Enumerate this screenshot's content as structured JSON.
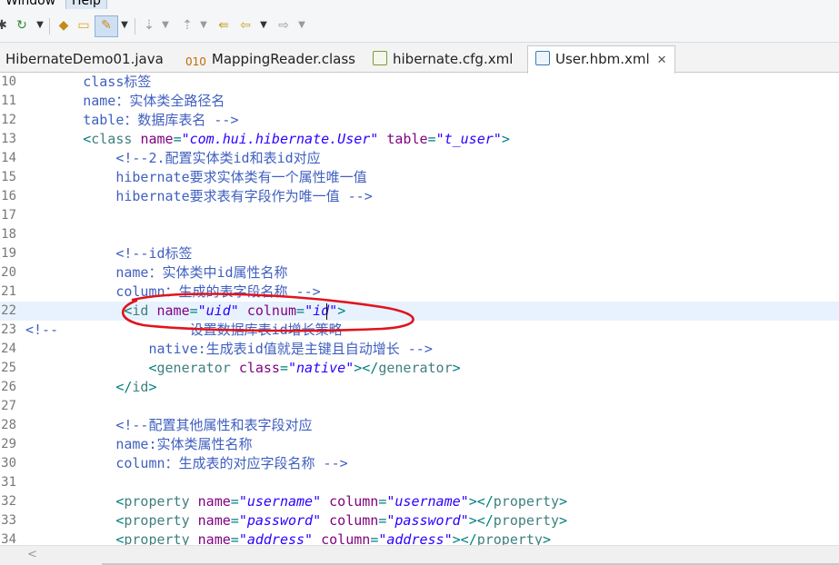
{
  "menubar": {
    "window": "Window",
    "help": "Help"
  },
  "tabs": [
    {
      "label": "HibernateDemo01.java",
      "icon": "java-file-icon"
    },
    {
      "label": "MappingReader.class",
      "icon": "class-file-icon",
      "icon_text": "010"
    },
    {
      "label": "hibernate.cfg.xml",
      "icon": "xml-file-icon"
    },
    {
      "label": "User.hbm.xml",
      "icon": "hbm-xml-file-icon",
      "active": true,
      "close": "✕"
    }
  ],
  "editor": {
    "lines": [
      {
        "n": "10",
        "indent": "       ",
        "segs": [
          [
            "c-com",
            "class标签"
          ]
        ]
      },
      {
        "n": "11",
        "indent": "       ",
        "segs": [
          [
            "c-com",
            "name：实体类全路径名"
          ]
        ]
      },
      {
        "n": "12",
        "indent": "       ",
        "segs": [
          [
            "c-com",
            "table：数据库表名 -->"
          ]
        ]
      },
      {
        "n": "13",
        "indent": "       ",
        "segs": [
          [
            "c-punc",
            "<"
          ],
          [
            "c-tag",
            "class "
          ],
          [
            "c-attr",
            "name"
          ],
          [
            "c-punc",
            "="
          ],
          [
            "c-str",
            "\"com.hui.hibernate.User\""
          ],
          [
            "c-attr",
            " table"
          ],
          [
            "c-punc",
            "="
          ],
          [
            "c-str",
            "\"t_user\""
          ],
          [
            "c-punc",
            ">"
          ]
        ]
      },
      {
        "n": "14",
        "indent": "           ",
        "segs": [
          [
            "c-com",
            "<!--2.配置实体类id和表id对应"
          ]
        ]
      },
      {
        "n": "15",
        "indent": "           ",
        "segs": [
          [
            "c-com",
            "hibernate要求实体类有一个属性唯一值"
          ]
        ]
      },
      {
        "n": "16",
        "indent": "           ",
        "segs": [
          [
            "c-com",
            "hibernate要求表有字段作为唯一值 -->"
          ]
        ]
      },
      {
        "n": "17",
        "indent": "",
        "segs": []
      },
      {
        "n": "18",
        "indent": "",
        "segs": []
      },
      {
        "n": "19",
        "indent": "           ",
        "segs": [
          [
            "c-com",
            "<!--id标签"
          ]
        ]
      },
      {
        "n": "20",
        "indent": "           ",
        "segs": [
          [
            "c-com",
            "name：实体类中id属性名称"
          ]
        ]
      },
      {
        "n": "21",
        "indent": "           ",
        "segs": [
          [
            "c-com",
            "column：生成的表字段名称 -->"
          ]
        ]
      },
      {
        "n": "22",
        "indent": "            ",
        "current": true,
        "segs": [
          [
            "c-punc",
            "<"
          ],
          [
            "c-tag",
            "id "
          ],
          [
            "c-attr",
            "name"
          ],
          [
            "c-punc",
            "="
          ],
          [
            "c-str",
            "\"uid\""
          ],
          [
            "c-attr",
            " colnum"
          ],
          [
            "c-punc",
            "="
          ],
          [
            "c-str",
            "\"id\""
          ],
          [
            "c-punc",
            ">"
          ]
        ]
      },
      {
        "n": "23",
        "indent": "",
        "segs": [
          [
            "c-com",
            "<!--                设置数据库表id增长策略"
          ]
        ]
      },
      {
        "n": "24",
        "indent": "               ",
        "segs": [
          [
            "c-com",
            "native:生成表id值就是主键且自动增长 -->"
          ]
        ]
      },
      {
        "n": "25",
        "indent": "               ",
        "segs": [
          [
            "c-punc",
            "<"
          ],
          [
            "c-tag",
            "generator "
          ],
          [
            "c-attr",
            "class"
          ],
          [
            "c-punc",
            "="
          ],
          [
            "c-str",
            "\"native\""
          ],
          [
            "c-punc",
            "></"
          ],
          [
            "c-tag",
            "generator"
          ],
          [
            "c-punc",
            ">"
          ]
        ]
      },
      {
        "n": "26",
        "indent": "           ",
        "segs": [
          [
            "c-punc",
            "</"
          ],
          [
            "c-tag",
            "id"
          ],
          [
            "c-punc",
            ">"
          ]
        ]
      },
      {
        "n": "27",
        "indent": "",
        "segs": []
      },
      {
        "n": "28",
        "indent": "           ",
        "segs": [
          [
            "c-com",
            "<!--配置其他属性和表字段对应"
          ]
        ]
      },
      {
        "n": "29",
        "indent": "           ",
        "segs": [
          [
            "c-com",
            "name:实体类属性名称"
          ]
        ]
      },
      {
        "n": "30",
        "indent": "           ",
        "segs": [
          [
            "c-com",
            "column：生成表的对应字段名称 -->"
          ]
        ]
      },
      {
        "n": "31",
        "indent": "",
        "segs": []
      },
      {
        "n": "32",
        "indent": "           ",
        "segs": [
          [
            "c-punc",
            "<"
          ],
          [
            "c-tag",
            "property "
          ],
          [
            "c-attr",
            "name"
          ],
          [
            "c-punc",
            "="
          ],
          [
            "c-str",
            "\"username\""
          ],
          [
            "c-attr",
            " column"
          ],
          [
            "c-punc",
            "="
          ],
          [
            "c-str",
            "\"username\""
          ],
          [
            "c-punc",
            "></"
          ],
          [
            "c-tag",
            "property"
          ],
          [
            "c-punc",
            ">"
          ]
        ]
      },
      {
        "n": "33",
        "indent": "           ",
        "segs": [
          [
            "c-punc",
            "<"
          ],
          [
            "c-tag",
            "property "
          ],
          [
            "c-attr",
            "name"
          ],
          [
            "c-punc",
            "="
          ],
          [
            "c-str",
            "\"password\""
          ],
          [
            "c-attr",
            " column"
          ],
          [
            "c-punc",
            "="
          ],
          [
            "c-str",
            "\"password\""
          ],
          [
            "c-punc",
            "></"
          ],
          [
            "c-tag",
            "property"
          ],
          [
            "c-punc",
            ">"
          ]
        ]
      },
      {
        "n": "34",
        "indent": "           ",
        "segs": [
          [
            "c-punc",
            "<"
          ],
          [
            "c-tag",
            "property "
          ],
          [
            "c-attr",
            "name"
          ],
          [
            "c-punc",
            "="
          ],
          [
            "c-str",
            "\"address\""
          ],
          [
            "c-attr",
            " column"
          ],
          [
            "c-punc",
            "="
          ],
          [
            "c-str",
            "\"address\""
          ],
          [
            "c-punc",
            "></"
          ],
          [
            "c-tag",
            "property"
          ],
          [
            "c-punc",
            ">"
          ]
        ]
      }
    ]
  },
  "colors": {
    "comment": "#3f5fbf",
    "tag": "#3f7f7f",
    "attribute": "#7f007f",
    "string": "#2a00ff",
    "current_line": "#e8f2fe",
    "annotation": "#e0141e"
  },
  "scrollbar": {
    "left_arrow": "<"
  }
}
